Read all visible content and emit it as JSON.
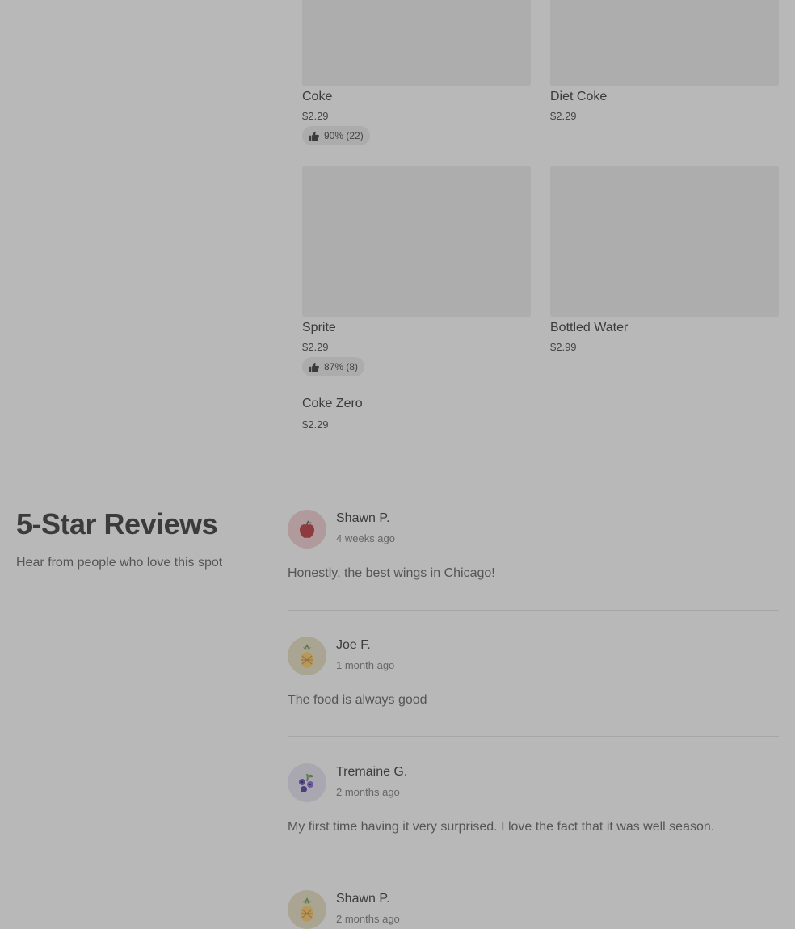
{
  "menu": {
    "items": [
      {
        "name": "Coke",
        "price": "$2.29",
        "rating": "90% (22)"
      },
      {
        "name": "Diet Coke",
        "price": "$2.29"
      },
      {
        "name": "Sprite",
        "price": "$2.29",
        "rating": "87% (8)"
      },
      {
        "name": "Bottled Water",
        "price": "$2.99"
      },
      {
        "name": "Coke Zero",
        "price": "$2.29"
      }
    ]
  },
  "reviews_section": {
    "title": "5-Star Reviews",
    "subtitle": "Hear from people who love this spot",
    "reviews": [
      {
        "name": "Shawn P.",
        "date": "4 weeks ago",
        "text": "Honestly, the best wings in Chicago!",
        "avatar": "apple-icon"
      },
      {
        "name": "Joe F.",
        "date": "1 month ago",
        "text": "The food is always good",
        "avatar": "pineapple-icon"
      },
      {
        "name": "Tremaine G.",
        "date": "2 months ago",
        "text": "My first time having it very surprised. I love the fact that it was well season.",
        "avatar": "blueberry-icon"
      },
      {
        "name": "Shawn P.",
        "date": "2 months ago",
        "text": "",
        "avatar": "pineapple-icon"
      }
    ]
  },
  "colors": {
    "background": "#b8b8b8",
    "image_placeholder": "#adadad",
    "pill": "#acacac"
  }
}
